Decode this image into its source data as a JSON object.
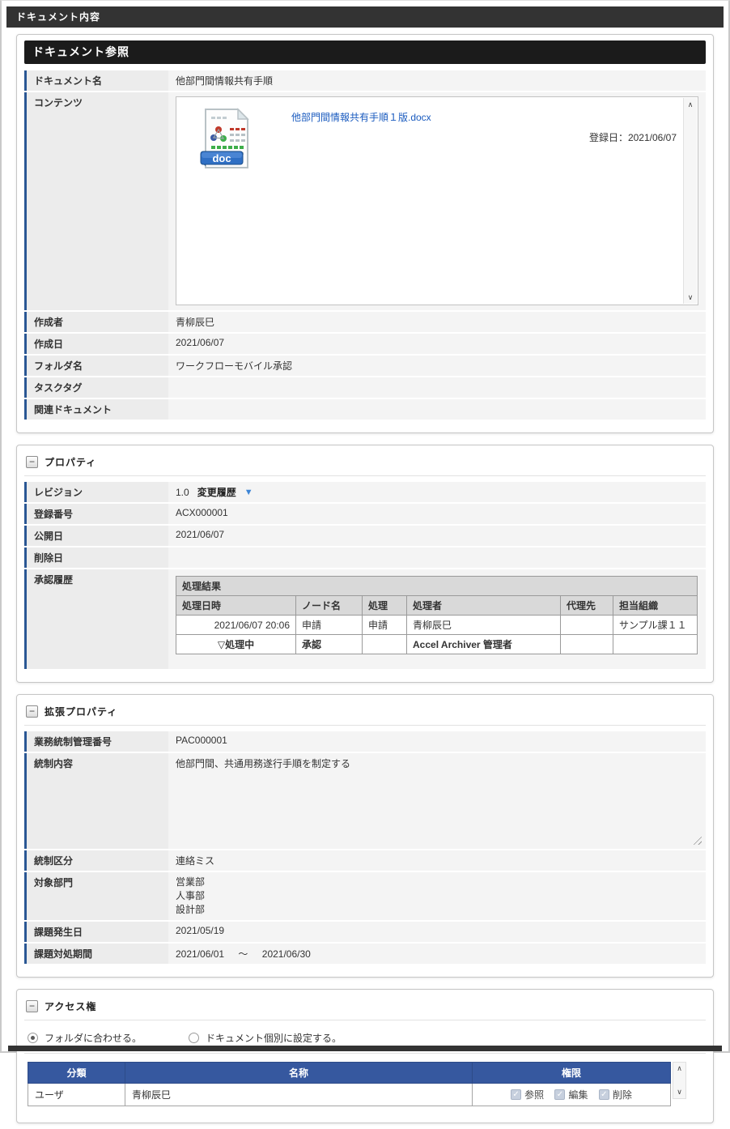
{
  "header": {
    "page_title": "ドキュメント内容",
    "view_title": "ドキュメント参照"
  },
  "icons": {
    "collapse": "−",
    "dropdown_arrow": "▼",
    "scroll_up": "∧",
    "scroll_down": "∨"
  },
  "doc": {
    "name_label": "ドキュメント名",
    "name_value": "他部門間情報共有手順",
    "contents_label": "コンテンツ",
    "file_link": "他部門間情報共有手順１版.docx",
    "file_badge": "doc",
    "reg_date": "登録日：2021/06/07",
    "creator_label": "作成者",
    "creator_value": "青柳辰巳",
    "created_label": "作成日",
    "created_value": "2021/06/07",
    "folder_label": "フォルダ名",
    "folder_value": "ワークフローモバイル承認",
    "tasktag_label": "タスクタグ",
    "tasktag_value": "",
    "related_label": "関連ドキュメント",
    "related_value": ""
  },
  "properties": {
    "title": "プロパティ",
    "revision_label": "レビジョン",
    "revision_value": "1.0",
    "history_link": "変更履歴",
    "regno_label": "登録番号",
    "regno_value": "ACX000001",
    "publish_label": "公開日",
    "publish_value": "2021/06/07",
    "delete_label": "削除日",
    "delete_value": "",
    "approval_label": "承認履歴",
    "approval_table": {
      "caption": "処理結果",
      "headers": [
        "処理日時",
        "ノード名",
        "処理",
        "処理者",
        "代理先",
        "担当組織"
      ],
      "rows": [
        [
          "2021/06/07 20:06",
          "申請",
          "申請",
          "青柳辰巳",
          "",
          "サンプル課１１"
        ],
        [
          "▽処理中",
          "承認",
          "",
          "Accel Archiver 管理者",
          "",
          ""
        ]
      ]
    }
  },
  "extended": {
    "title": "拡張プロパティ",
    "ctrl_no_label": "業務統制管理番号",
    "ctrl_no_value": "PAC000001",
    "ctrl_content_label": "統制内容",
    "ctrl_content_value": "他部門間、共通用務遂行手順を制定する",
    "ctrl_class_label": "統制区分",
    "ctrl_class_value": "連絡ミス",
    "target_label": "対象部門",
    "target_values": [
      "営業部",
      "人事部",
      "設計部"
    ],
    "issue_date_label": "課題発生日",
    "issue_date_value": "2021/05/19",
    "period_label": "課題対処期間",
    "period_from": "2021/06/01",
    "period_tilde": "～",
    "period_to": "2021/06/30"
  },
  "access": {
    "title": "アクセス権",
    "radio_folder": "フォルダに合わせる。",
    "radio_individual": "ドキュメント個別に設定する。",
    "table_headers": [
      "分類",
      "名称",
      "権限"
    ],
    "row": {
      "category": "ユーザ",
      "name": "青柳辰巳"
    },
    "perm_labels": [
      "参照",
      "編集",
      "削除"
    ]
  },
  "colors": {
    "accent_bar_blue": "#2a5794",
    "table_header_blue": "#36589f",
    "link_blue": "#1a5bbf",
    "dark_bar": "#333333",
    "view_header_black": "#1b1b1b"
  }
}
